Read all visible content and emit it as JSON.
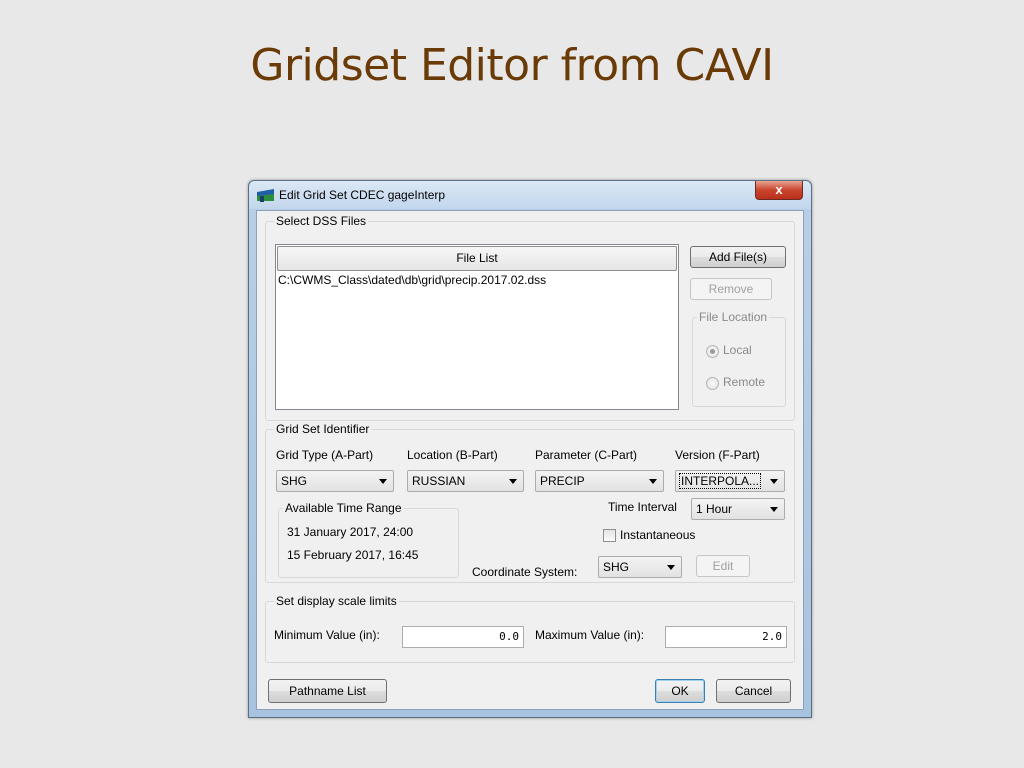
{
  "slide": {
    "title": "Gridset Editor from CAVI"
  },
  "window": {
    "title": "Edit Grid Set CDEC gageInterp",
    "close_glyph": "x"
  },
  "dss_files": {
    "group_label": "Select DSS Files",
    "list_header": "File List",
    "files": [
      "C:\\CWMS_Class\\dated\\db\\grid\\precip.2017.02.dss"
    ],
    "add_button": "Add File(s)",
    "remove_button": "Remove",
    "file_location": {
      "label": "File Location",
      "options": [
        {
          "label": "Local",
          "checked": true,
          "enabled": false
        },
        {
          "label": "Remote",
          "checked": false,
          "enabled": false
        }
      ]
    }
  },
  "grid_set_identifier": {
    "group_label": "Grid Set Identifier",
    "grid_type": {
      "label": "Grid Type (A-Part)",
      "value": "SHG"
    },
    "location": {
      "label": "Location (B-Part)",
      "value": "RUSSIAN"
    },
    "parameter": {
      "label": "Parameter (C-Part)",
      "value": "PRECIP"
    },
    "version": {
      "label": "Version (F-Part)",
      "value": "INTERPOLA..."
    },
    "time_range": {
      "label": "Available Time Range",
      "start": "31 January 2017, 24:00",
      "end": "15 February 2017, 16:45"
    },
    "time_interval": {
      "label": "Time Interval",
      "value": "1 Hour"
    },
    "instantaneous": {
      "label": "Instantaneous",
      "checked": false
    },
    "coordinate_system": {
      "label": "Coordinate System:",
      "value": "SHG"
    },
    "edit_button": "Edit"
  },
  "scale_limits": {
    "group_label": "Set display scale limits",
    "min": {
      "label": "Minimum Value (in):",
      "value": "0.0"
    },
    "max": {
      "label": "Maximum Value (in):",
      "value": "2.0"
    }
  },
  "footer": {
    "pathname_button": "Pathname List",
    "ok_button": "OK",
    "cancel_button": "Cancel"
  }
}
